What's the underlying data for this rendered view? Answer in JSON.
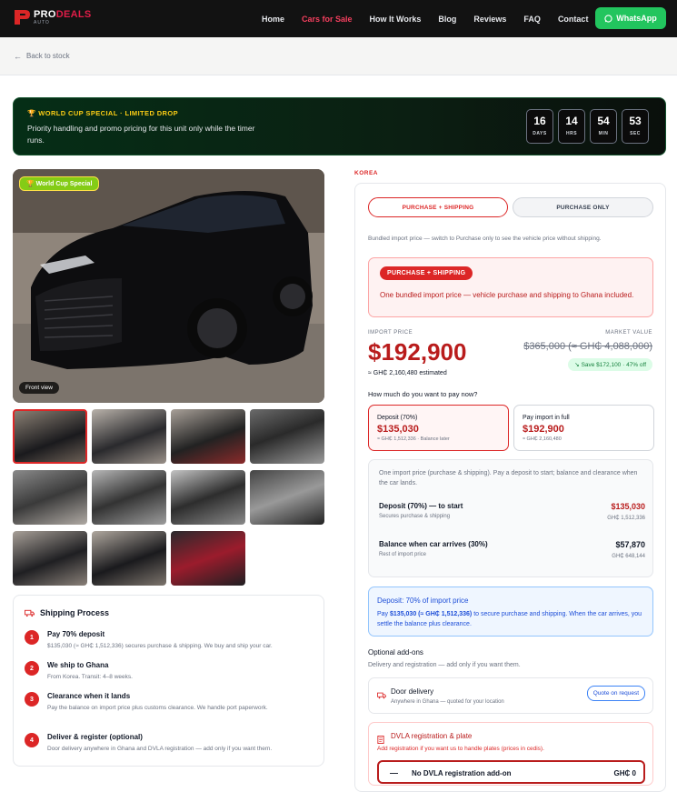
{
  "brand": {
    "name_a": "PRO",
    "name_b": "DEALS",
    "sub": "AUTO"
  },
  "nav": {
    "items": [
      "Home",
      "Cars for Sale",
      "How It Works",
      "Blog",
      "Reviews",
      "FAQ",
      "Contact"
    ],
    "active": "Cars for Sale",
    "whatsapp": "WhatsApp"
  },
  "back": {
    "label": "Back to stock"
  },
  "promo": {
    "title": "WORLD CUP SPECIAL · LIMITED DROP",
    "desc": "Priority handling and promo pricing for this unit only while the timer runs.",
    "timer": [
      {
        "value": "16",
        "unit": "DAYS"
      },
      {
        "value": "14",
        "unit": "HRS"
      },
      {
        "value": "54",
        "unit": "MIN"
      },
      {
        "value": "53",
        "unit": "SEC"
      }
    ]
  },
  "gallery": {
    "badge": "World Cup Special",
    "caption": "Front view",
    "thumb_count": 11,
    "selected": 0
  },
  "shipping": {
    "title": "Shipping Process",
    "steps": [
      {
        "n": "1",
        "title": "Pay 70% deposit",
        "desc": "$135,030 (≈ GH₵ 1,512,336) secures purchase & shipping. We buy and ship your car."
      },
      {
        "n": "2",
        "title": "We ship to Ghana",
        "desc": "From Korea. Transit: 4–8 weeks."
      },
      {
        "n": "3",
        "title": "Clearance when it lands",
        "desc": "Pay the balance on import price plus customs clearance. We handle port paperwork."
      },
      {
        "n": "4",
        "title": "Deliver & register (optional)",
        "desc": "Door delivery anywhere in Ghana and DVLA registration — add only if you want them."
      }
    ]
  },
  "origin": "KOREA",
  "panel": {
    "toggle": {
      "a": "PURCHASE + SHIPPING",
      "b": "PURCHASE ONLY"
    },
    "bundled_note": "Bundled import price — switch to Purchase only to see the vehicle price without shipping.",
    "pill": "PURCHASE + SHIPPING",
    "pill_text": "One bundled import price — vehicle purchase and shipping to Ghana included.",
    "import_label": "IMPORT PRICE",
    "market_label": "MARKET VALUE",
    "price": "$192,900",
    "price_ghs": "≈ GH₵ 2,160,480 estimated",
    "market": "$365,000 (≈ GH₵ 4,088,000)",
    "save": "Save $172,100 · 47% off",
    "question": "How much do you want to pay now?",
    "options": [
      {
        "label": "Deposit (70%)",
        "amount": "$135,030",
        "note": "≈ GH₵ 1,512,336 · Balance later"
      },
      {
        "label": "Pay import in full",
        "amount": "$192,900",
        "note": "≈ GH₵ 2,160,480"
      }
    ],
    "breakdown": {
      "desc": "One import price (purchase & shipping). Pay a deposit to start; balance and clearance when the car lands.",
      "rows": [
        {
          "label": "Deposit (70%) — to start",
          "sub": "Secures purchase & shipping",
          "amount": "$135,030",
          "ghs": "GH₵ 1,512,336",
          "color": "#b91c1c"
        },
        {
          "label": "Balance when car arrives (30%)",
          "sub": "Rest of import price",
          "amount": "$57,870",
          "ghs": "GH₵ 648,144",
          "color": "#111827"
        }
      ]
    },
    "info": {
      "title": "Deposit: 70% of import price",
      "pre": "Pay ",
      "bold": "$135,030 (≈ GH₵ 1,512,336)",
      "post": " to secure purchase and shipping. When the car arrives, you settle the balance plus clearance."
    },
    "addons": {
      "title": "Optional add-ons",
      "sub": "Delivery and registration — add only if you want them.",
      "door": {
        "title": "Door delivery",
        "sub": "Anywhere in Ghana — quoted for your location",
        "button": "Quote on request"
      },
      "dvla": {
        "title": "DVLA registration & plate",
        "sub": "Add registration if you want us to handle plates (prices in cedis).",
        "option_mark": "—",
        "option": "No DVLA registration add-on",
        "option_price": "GH₵ 0"
      }
    }
  },
  "colors": {
    "accent": "#dc2626",
    "promo_bg": "#052e16",
    "success": "#22c55e",
    "info": "#1d4ed8"
  }
}
